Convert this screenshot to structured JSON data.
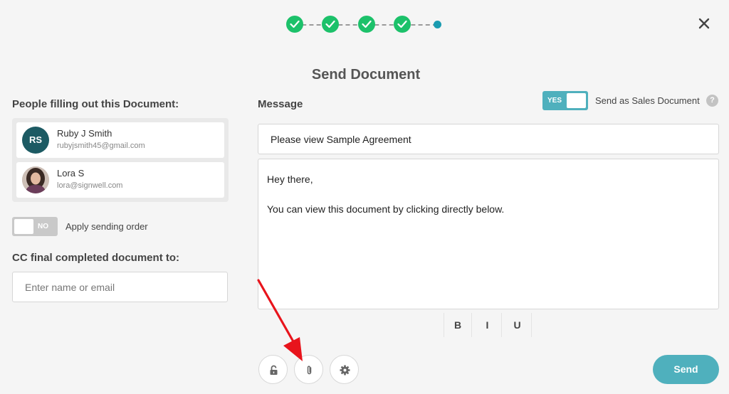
{
  "stepper": {
    "completed_steps": 4,
    "total_steps": 5,
    "complete_color": "#1cc16a",
    "current_color": "#1a9bb0"
  },
  "header": {
    "title": "Send Document",
    "close_icon": "close-icon"
  },
  "people": {
    "label": "People filling out this Document:",
    "signers": [
      {
        "initials": "RS",
        "name": "Ruby J Smith",
        "email": "rubyjsmith45@gmail.com"
      },
      {
        "initials": "",
        "name": "Lora S",
        "email": "lora@signwell.com"
      }
    ]
  },
  "sending_order": {
    "toggle_label": "NO",
    "label": "Apply sending order"
  },
  "cc": {
    "label": "CC final completed document to:",
    "placeholder": "Enter name or email"
  },
  "message": {
    "label": "Message",
    "subject": "Please view Sample Agreement",
    "body_line1": "Hey there,",
    "body_line2": "You can view this document by clicking directly below."
  },
  "sales_doc": {
    "toggle_label": "YES",
    "label": "Send as Sales Document",
    "help_icon": "?"
  },
  "formatting": {
    "bold": "B",
    "italic": "I",
    "underline": "U"
  },
  "footer_icons": [
    "lock-icon",
    "paperclip-icon",
    "gear-icon"
  ],
  "send_button": "Send",
  "colors": {
    "accent": "#4fb0bd",
    "annotation_arrow": "#e8141c"
  }
}
